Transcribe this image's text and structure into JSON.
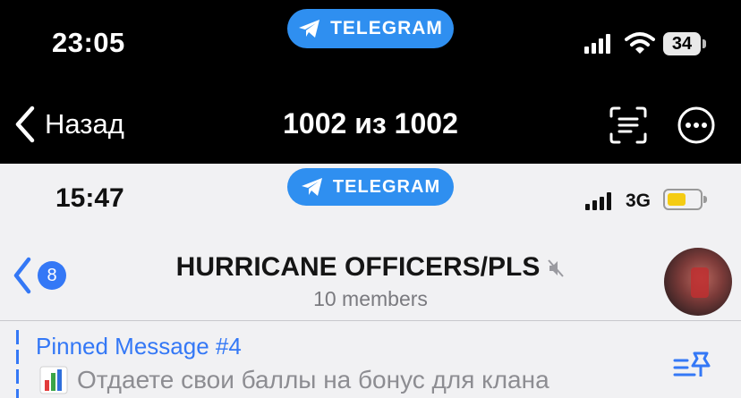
{
  "outer_status": {
    "time": "23:05",
    "pill_label": "TELEGRAM",
    "battery": "34"
  },
  "outer_nav": {
    "back_label": "Назад",
    "counter": "1002 из 1002"
  },
  "inner_status": {
    "time": "15:47",
    "pill_label": "TELEGRAM",
    "network": "3G"
  },
  "chat": {
    "back_badge": "8",
    "title": "HURRICANE OFFICERS/PLS",
    "members": "10 members",
    "pinned_title": "Pinned Message #4",
    "pinned_text": "Отдаете свои баллы на бонус для клана"
  },
  "colors": {
    "accent": "#3478f6",
    "pill": "#2f8ff0",
    "battery_low": "#f5cc14"
  },
  "icons": [
    "telegram-plane-icon",
    "signal-icon",
    "wifi-icon",
    "battery-icon",
    "chevron-left-icon",
    "scan-text-icon",
    "more-icon",
    "mute-icon",
    "bar-chart-emoji-icon",
    "pin-list-icon"
  ]
}
